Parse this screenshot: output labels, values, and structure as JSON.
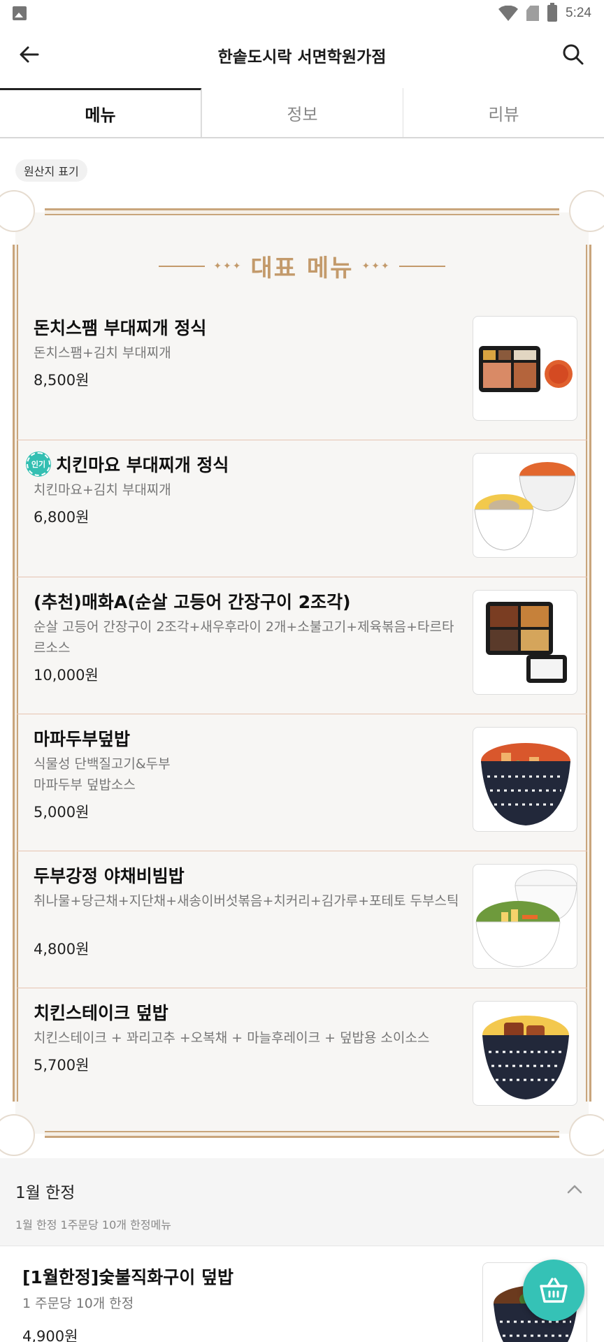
{
  "status_bar": {
    "time": "5:24"
  },
  "app_bar": {
    "title": "한솥도시락 서면학원가점"
  },
  "tabs": [
    {
      "label": "메뉴"
    },
    {
      "label": "정보"
    },
    {
      "label": "리뷰"
    }
  ],
  "origin_chip": "원산지 표기",
  "featured": {
    "title": "대표 메뉴",
    "dots": "✦✦✦",
    "items": [
      {
        "name": "돈치스팸 부대찌개 정식",
        "desc": "돈치스팸+김치 부대찌개",
        "price": "8,500원"
      },
      {
        "name": "치킨마요 부대찌개 정식",
        "badge": "인기",
        "desc": "치킨마요+김치 부대찌개",
        "price": "6,800원"
      },
      {
        "name": "(추천)매화A(순살 고등어 간장구이 2조각)",
        "desc": "순살 고등어 간장구이 2조각+새우후라이 2개+소불고기+제육볶음+타르타르소스",
        "price": "10,000원"
      },
      {
        "name": "마파두부덮밥",
        "desc": "식물성 단백질고기&두부\n마파두부 덮밥소스",
        "price": "5,000원"
      },
      {
        "name": "두부강정 야채비빔밥",
        "desc": "취나물+당근채+지단채+새송이버섯볶음+치커리+김가루+포테토 두부스틱",
        "price": "4,800원"
      },
      {
        "name": "치킨스테이크 덮밥",
        "desc": "치킨스테이크 + 꽈리고추 +오복채 + 마늘후레이크 + 덮밥용 소이소스",
        "price": "5,700원"
      }
    ]
  },
  "section": {
    "title": "1월 한정",
    "subtitle": "1월 한정 1주문당 10개 한정메뉴",
    "items": [
      {
        "name": "[1월한정]숯불직화구이 덮밥",
        "desc": "1 주문당 10개 한정",
        "price": "4,900원"
      }
    ]
  },
  "colors": {
    "accent": "#35c2b6",
    "gold": "#c39a6b",
    "divider": "#e6c3b0"
  }
}
